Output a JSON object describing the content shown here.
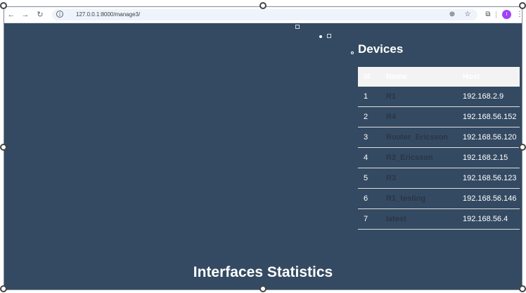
{
  "browser": {
    "url": "127.0.0.1:8000/manage3/",
    "icons": {
      "back": "arrow-left-icon",
      "forward": "arrow-right-icon",
      "reload": "reload-icon",
      "info": "info-icon",
      "zoom": "zoom-icon",
      "bookmark": "star-icon",
      "extensions": "puzzle-icon",
      "menu": "kebab-menu-icon"
    },
    "avatar_letter": "I",
    "avatar_color": "#a142f4"
  },
  "page": {
    "background": "#344a62",
    "devices_title": "Devices",
    "table": {
      "headers": [
        "Id",
        "Name",
        "Host"
      ],
      "rows": [
        {
          "id": "1",
          "name": "R1",
          "host": "192.168.2.9"
        },
        {
          "id": "2",
          "name": "R4",
          "host": "192.168.56.152"
        },
        {
          "id": "3",
          "name": "Router_Ericsson",
          "host": "192.168.56.120"
        },
        {
          "id": "4",
          "name": "R2_Ericsson",
          "host": "192.168.2.15"
        },
        {
          "id": "5",
          "name": "R3",
          "host": "192.168.56.123"
        },
        {
          "id": "6",
          "name": "R1_testing",
          "host": "192.168.56.146"
        },
        {
          "id": "7",
          "name": "latest",
          "host": "192.168.56.4"
        }
      ]
    },
    "stats_title": "Interfaces Statistics"
  }
}
